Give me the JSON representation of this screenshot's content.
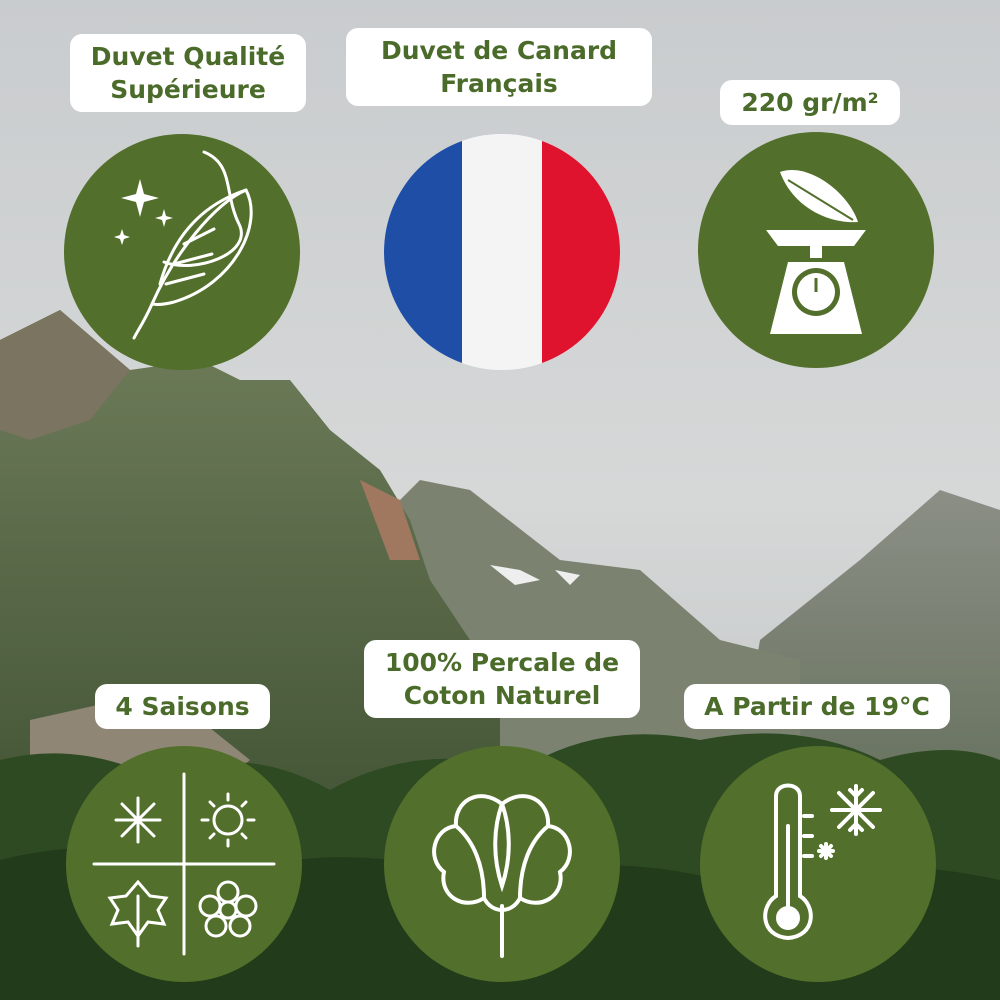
{
  "badges": [
    {
      "lines": [
        "Duvet Qualité",
        "Supérieure"
      ],
      "icon": "feather-sparkle-icon"
    },
    {
      "lines": [
        "Duvet de Canard",
        "Français"
      ],
      "icon": "french-flag-icon"
    },
    {
      "lines": [
        "220 gr/m²"
      ],
      "icon": "scale-feather-icon"
    },
    {
      "lines": [
        "4 Saisons"
      ],
      "icon": "four-seasons-icon"
    },
    {
      "lines": [
        "100% Percale de",
        "Coton Naturel"
      ],
      "icon": "cotton-flower-icon"
    },
    {
      "lines": [
        "A Partir de 19°C"
      ],
      "icon": "thermometer-snowflake-icon"
    }
  ],
  "colors": {
    "badge_green": "#526f2b",
    "label_text": "#4a6b29",
    "flag_blue": "#1f4ea6",
    "flag_white": "#f4f4f4",
    "flag_red": "#e0132f"
  }
}
